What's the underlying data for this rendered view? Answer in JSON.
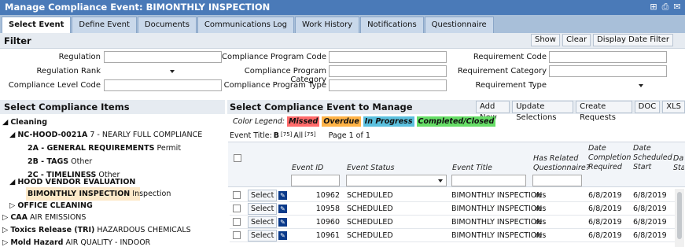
{
  "window": {
    "title": "Manage Compliance Event: BIMONTHLY INSPECTION"
  },
  "tabs": [
    "Select Event",
    "Define Event",
    "Documents",
    "Communications Log",
    "Work History",
    "Notifications",
    "Questionnaire"
  ],
  "filter": {
    "title": "Filter",
    "show": "Show",
    "clear": "Clear",
    "display_date_filter": "Display Date Filter",
    "regulation": "Regulation",
    "regulation_rank": "Regulation Rank",
    "compliance_level_code": "Compliance Level Code",
    "program_code": "Compliance Program Code",
    "program_category": "Compliance Program Category",
    "program_type": "Compliance Program Type",
    "requirement_code": "Requirement Code",
    "requirement_category": "Requirement Category",
    "requirement_type": "Requirement Type"
  },
  "left": {
    "title": "Select Compliance Items",
    "tree": [
      {
        "bold": "Cleaning",
        "rest": ""
      },
      {
        "bold": "NC-HOOD-0021A",
        "rest": " 7 - NEARLY FULL COMPLIANCE"
      },
      {
        "bold": "2A - GENERAL REQUIREMENTS",
        "rest": " Permit"
      },
      {
        "bold": "2B - TAGS",
        "rest": " Other"
      },
      {
        "bold": "2C - TIMELINESS",
        "rest": " Other"
      },
      {
        "bold": "HOOD VENDOR EVALUATION",
        "rest": ""
      },
      {
        "bold": "BIMONTHLY INSPECTION",
        "rest": " Inspection"
      },
      {
        "bold": "OFFICE CLEANING",
        "rest": ""
      },
      {
        "bold": "CAA",
        "rest": " AIR EMISSIONS"
      },
      {
        "bold": "Toxics Release (TRI)",
        "rest": " HAZARDOUS CHEMICALS"
      },
      {
        "bold": "Mold Hazard",
        "rest": " AIR QUALITY - INDOOR"
      }
    ]
  },
  "right": {
    "title": "Select Compliance Event to Manage",
    "add_new": "Add New",
    "update": "Update Selections",
    "create": "Create Requests",
    "doc": "DOC",
    "xls": "XLS",
    "legend_label": "Color Legend:",
    "legend": [
      "Missed",
      "Overdue",
      "In Progress",
      "Completed/Closed"
    ],
    "legend_colors": [
      "#ff6b6b",
      "#ffb347",
      "#5bc0de",
      "#66dd66"
    ],
    "event_title_label": "Event Title:",
    "b_label": "B",
    "b_count": "[75]",
    "all_label": "All",
    "all_count": "[75]",
    "page": "Page 1 of 1",
    "columns": [
      "Event ID",
      "Event Status",
      "Event Title",
      "Has Related Questionnaire?",
      "Date Completion Required",
      "Date Scheduled Start",
      "Dat Sta"
    ],
    "rows": [
      {
        "select": "Select",
        "id": "10962",
        "status": "SCHEDULED",
        "title": "BIMONTHLY INSPECTION",
        "q": "Yes",
        "req": "6/8/2019",
        "start": "6/8/2019"
      },
      {
        "select": "Select",
        "id": "10958",
        "status": "SCHEDULED",
        "title": "BIMONTHLY INSPECTION",
        "q": "Yes",
        "req": "6/8/2019",
        "start": "6/8/2019"
      },
      {
        "select": "Select",
        "id": "10960",
        "status": "SCHEDULED",
        "title": "BIMONTHLY INSPECTION",
        "q": "Yes",
        "req": "6/8/2019",
        "start": "6/8/2019"
      },
      {
        "select": "Select",
        "id": "10961",
        "status": "SCHEDULED",
        "title": "BIMONTHLY INSPECTION",
        "q": "Yes",
        "req": "6/8/2019",
        "start": "6/8/2019"
      }
    ]
  }
}
